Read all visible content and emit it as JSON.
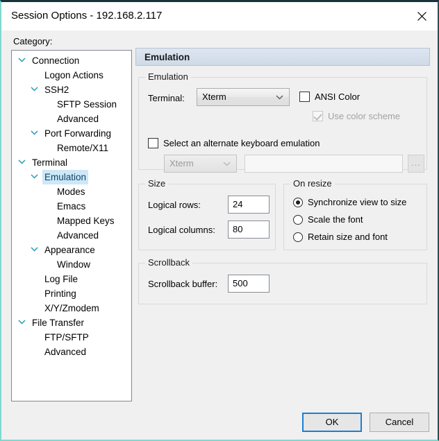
{
  "window": {
    "title": "Session Options - 192.168.2.117",
    "close_icon": "close-icon"
  },
  "sidebar": {
    "label": "Category:",
    "items": [
      {
        "label": "Connection",
        "level": 0,
        "expander": "chevron-down",
        "selected": false
      },
      {
        "label": "Logon Actions",
        "level": 1,
        "expander": "",
        "selected": false
      },
      {
        "label": "SSH2",
        "level": 1,
        "expander": "chevron-down",
        "selected": false
      },
      {
        "label": "SFTP Session",
        "level": 2,
        "expander": "",
        "selected": false
      },
      {
        "label": "Advanced",
        "level": 2,
        "expander": "",
        "selected": false
      },
      {
        "label": "Port Forwarding",
        "level": 1,
        "expander": "chevron-down",
        "selected": false
      },
      {
        "label": "Remote/X11",
        "level": 2,
        "expander": "",
        "selected": false
      },
      {
        "label": "Terminal",
        "level": 0,
        "expander": "chevron-down",
        "selected": false
      },
      {
        "label": "Emulation",
        "level": 1,
        "expander": "chevron-down",
        "selected": true
      },
      {
        "label": "Modes",
        "level": 2,
        "expander": "",
        "selected": false
      },
      {
        "label": "Emacs",
        "level": 2,
        "expander": "",
        "selected": false
      },
      {
        "label": "Mapped Keys",
        "level": 2,
        "expander": "",
        "selected": false
      },
      {
        "label": "Advanced",
        "level": 2,
        "expander": "",
        "selected": false
      },
      {
        "label": "Appearance",
        "level": 1,
        "expander": "chevron-down",
        "selected": false
      },
      {
        "label": "Window",
        "level": 2,
        "expander": "",
        "selected": false
      },
      {
        "label": "Log File",
        "level": 1,
        "expander": "",
        "selected": false
      },
      {
        "label": "Printing",
        "level": 1,
        "expander": "",
        "selected": false
      },
      {
        "label": "X/Y/Zmodem",
        "level": 1,
        "expander": "",
        "selected": false
      },
      {
        "label": "File Transfer",
        "level": 0,
        "expander": "chevron-down",
        "selected": false
      },
      {
        "label": "FTP/SFTP",
        "level": 1,
        "expander": "",
        "selected": false
      },
      {
        "label": "Advanced",
        "level": 1,
        "expander": "",
        "selected": false
      }
    ]
  },
  "main": {
    "header": "Emulation",
    "emulation_group": {
      "title": "Emulation",
      "terminal_label": "Terminal:",
      "terminal_value": "Xterm",
      "ansi_color_label": "ANSI Color",
      "ansi_color_checked": false,
      "use_color_scheme_label": "Use color scheme",
      "use_color_scheme_checked": true,
      "use_color_scheme_disabled": true,
      "alt_keyboard_label": "Select an alternate keyboard emulation",
      "alt_keyboard_checked": false,
      "alt_keyboard_value": "Xterm",
      "alt_keyboard_path": "",
      "alt_keyboard_path_placeholder": "",
      "browse_label": "..."
    },
    "size_group": {
      "title": "Size",
      "rows_label": "Logical rows:",
      "rows_value": "24",
      "columns_label": "Logical columns:",
      "columns_value": "80"
    },
    "resize_group": {
      "title": "On resize",
      "options": [
        {
          "label": "Synchronize view to size",
          "selected": true
        },
        {
          "label": "Scale the font",
          "selected": false
        },
        {
          "label": "Retain size and font",
          "selected": false
        }
      ]
    },
    "scrollback_group": {
      "title": "Scrollback",
      "buffer_label": "Scrollback buffer:",
      "buffer_value": "500"
    }
  },
  "footer": {
    "ok_label": "OK",
    "cancel_label": "Cancel"
  },
  "colors": {
    "accent": "#1a7fd4",
    "selection": "#cde8f7",
    "expander": "#3aa6b9",
    "header_bg": "#d6e0ec"
  }
}
